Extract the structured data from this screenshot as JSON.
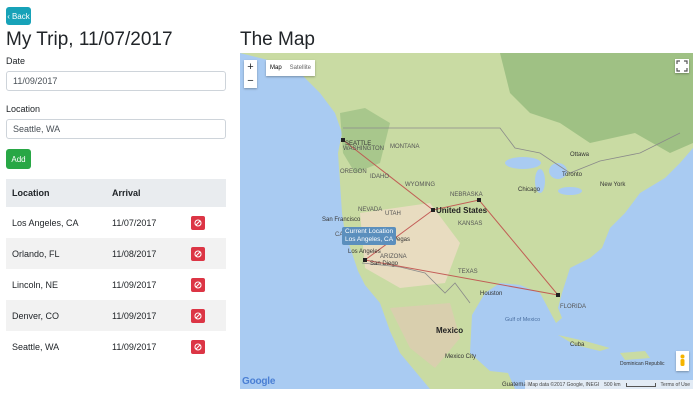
{
  "back_label": "Back",
  "page_title": "My Trip, 11/07/2017",
  "map_title": "The Map",
  "form": {
    "date_label": "Date",
    "date_value": "11/09/2017",
    "location_label": "Location",
    "location_value": "Seattle, WA",
    "add_label": "Add"
  },
  "table": {
    "headers": [
      "Location",
      "Arrival"
    ],
    "rows": [
      {
        "location": "Los Angeles, CA",
        "arrival": "11/07/2017"
      },
      {
        "location": "Orlando, FL",
        "arrival": "11/08/2017"
      },
      {
        "location": "Lincoln, NE",
        "arrival": "11/09/2017"
      },
      {
        "location": "Denver, CO",
        "arrival": "11/09/2017"
      },
      {
        "location": "Seattle, WA",
        "arrival": "11/09/2017"
      }
    ]
  },
  "map": {
    "type_map": "Map",
    "type_satellite": "Satellite",
    "zoom_in": "+",
    "zoom_out": "−",
    "info_line1": "Current Location",
    "info_line2": "Los Angeles, CA",
    "country_label": "United States",
    "mexico_label": "Mexico",
    "gulf_label": "Gulf of Mexico",
    "cuba_label": "Cuba",
    "google_logo": "Google",
    "attribution": "Map data ©2017 Google, INEGI",
    "scale": "500 km",
    "terms": "Terms of Use",
    "cities": {
      "seattle": "SEATTLE",
      "washington": "WASHINGTON",
      "montana": "MONTANA",
      "oregon": "OREGON",
      "idaho": "IDAHO",
      "wyoming": "WYOMING",
      "nevada": "NEVADA",
      "utah": "UTAH",
      "california": "CALIFORNIA",
      "arizona": "ARIZONA",
      "nebraska": "NEBRASKA",
      "kansas": "KANSAS",
      "texas": "TEXAS",
      "chicago": "Chicago",
      "ottawa": "Ottawa",
      "toronto": "Toronto",
      "new_york": "New York",
      "houston": "Houston",
      "san_francisco": "San Francisco",
      "las_vegas": "Las Vegas",
      "los_angeles": "Los Angeles",
      "san_diego": "San Diego",
      "mexico_city": "Mexico City",
      "guatemala": "Guatemala",
      "dominican": "Dominican Republic",
      "florida": "FLORIDA"
    }
  },
  "colors": {
    "back": "#17a2b8",
    "add": "#28a745",
    "delete": "#dc3545",
    "route": "#c0504d",
    "water": "#a9cbf2",
    "land": "#c9dba3"
  }
}
